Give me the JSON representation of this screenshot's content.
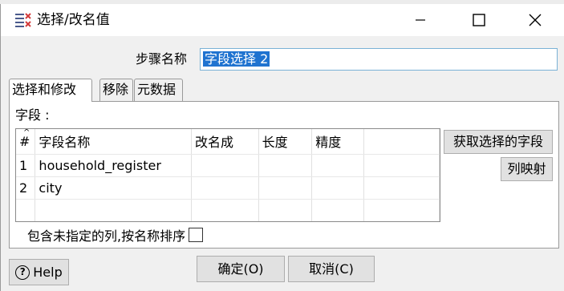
{
  "window": {
    "title": "选择/改名值"
  },
  "icons": {
    "app": "select-values-icon",
    "minimize": "minimize-icon",
    "maximize": "maximize-icon",
    "close": "close-icon",
    "help": "help-icon"
  },
  "step": {
    "label": "步骤名称",
    "value": "字段选择 2"
  },
  "tabs": [
    {
      "label": "选择和修改",
      "active": true
    },
    {
      "label": "移除",
      "active": false
    },
    {
      "label": "元数据",
      "active": false
    }
  ],
  "fields": {
    "label": "字段 :",
    "columns": [
      "#",
      "字段名称",
      "改名成",
      "长度",
      "精度"
    ],
    "rows": [
      {
        "num": "1",
        "name": "household_register",
        "rename": "",
        "length": "",
        "precision": ""
      },
      {
        "num": "2",
        "name": "city",
        "rename": "",
        "length": "",
        "precision": ""
      },
      {
        "num": "",
        "name": "",
        "rename": "",
        "length": "",
        "precision": ""
      }
    ]
  },
  "buttons": {
    "get_fields": "获取选择的字段",
    "column_mapping": "列映射",
    "help": "Help",
    "ok": "确定(O)",
    "cancel": "取消(C)"
  },
  "include_unspecified": {
    "label": "包含未指定的列,按名称排序",
    "checked": false
  }
}
